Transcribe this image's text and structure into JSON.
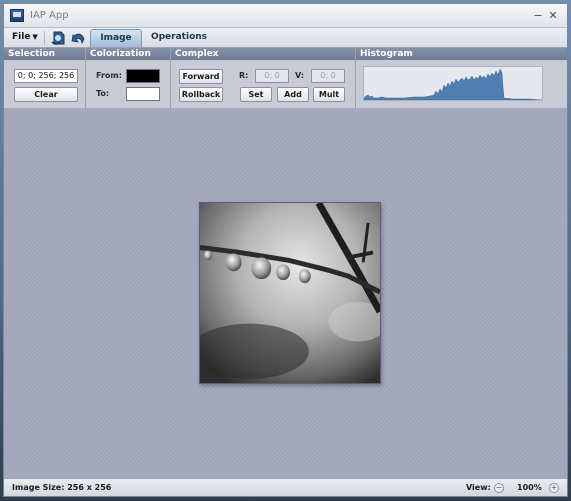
{
  "window": {
    "title": "IAP App",
    "minimize_label": "−",
    "close_label": "✕"
  },
  "menubar": {
    "file_label": "File",
    "tabs": [
      {
        "label": "Image",
        "active": true
      },
      {
        "label": "Operations",
        "active": false
      }
    ]
  },
  "panel": {
    "selection": {
      "header": "Selection",
      "value": "0; 0; 256; 256",
      "clear_label": "Clear"
    },
    "colorization": {
      "header": "Colorization",
      "from_label": "From:",
      "to_label": "To:",
      "from_color": "#000000",
      "to_color": "#ffffff"
    },
    "complex": {
      "header": "Complex",
      "forward_label": "Forward",
      "rollback_label": "Rollback",
      "r_label": "R:",
      "r_value": "0; 0",
      "v_label": "V:",
      "v_value": "0; 0",
      "set_label": "Set",
      "add_label": "Add",
      "mult_label": "Mult"
    },
    "histogram": {
      "header": "Histogram",
      "fill_color": "#4f7fb0"
    }
  },
  "status": {
    "image_size": "Image Size: 256 x 256",
    "view_label": "View:",
    "zoom": "100%",
    "zoom_out_label": "−",
    "zoom_in_label": "+"
  }
}
